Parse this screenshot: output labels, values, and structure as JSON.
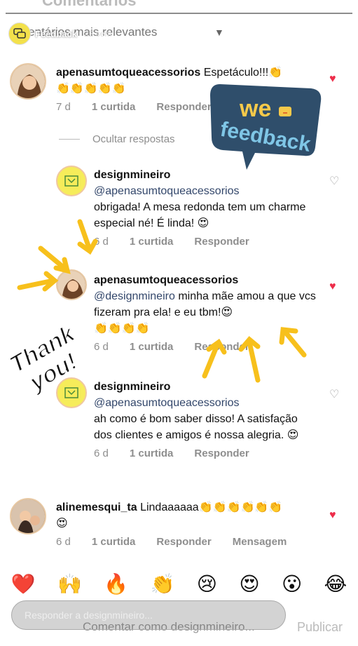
{
  "ghost_header": "Comentários",
  "story": {
    "name": "Feedback",
    "time": "22 sem",
    "ghost_subtitle": "mentários mais relevantes"
  },
  "comments": [
    {
      "username": "apenasumtoqueacessorios",
      "text": "Espetáculo!!!👏",
      "text2": "👏👏👏👏👏",
      "time": "7 d",
      "likes": "1 curtida",
      "reply": "Responder",
      "liked": true
    },
    {
      "username": "designmineiro",
      "mention": "@apenasumtoqueacessorios",
      "text": "obrigada! A mesa redonda tem um charme especial né! É linda! 😍",
      "time": "6 d",
      "likes": "1 curtida",
      "reply": "Responder",
      "liked": false
    },
    {
      "username": "apenasumtoqueacessorios",
      "mention": "@designmineiro",
      "text": "minha mãe amou a que vcs fizeram pra ela! e eu tbm!😍",
      "text2": "👏👏👏👏",
      "time": "6 d",
      "likes": "1 curtida",
      "reply": "Responder",
      "liked": true
    },
    {
      "username": "designmineiro",
      "mention": "@apenasumtoqueacessorios",
      "text": "ah como é bom saber disso! A satisfação dos clientes e amigos é nossa alegria. 😍",
      "time": "6 d",
      "likes": "1 curtida",
      "reply": "Responder",
      "liked": false
    },
    {
      "username": "alinemesqui_ta",
      "text": "Lindaaaaaa👏👏👏👏👏👏",
      "text2": "😍",
      "time": "6 d",
      "likes": "1 curtida",
      "reply": "Responder",
      "message": "Mensagem",
      "liked": true
    }
  ],
  "hide_replies": "Ocultar respostas",
  "emoji_bar": [
    "❤️",
    "🙌",
    "🔥",
    "👏",
    "😢",
    "😍",
    "😮",
    "😂"
  ],
  "compose": {
    "placeholder": "Responder a designmineiro...",
    "ghost_text": "Comentar como designmineiro...",
    "ghost_publish": "Publicar"
  },
  "stickers": {
    "we_top": "we",
    "we_bottom": "feedback",
    "thanks_line1": "Thank",
    "thanks_line2": "you!"
  },
  "colors": {
    "heart_red": "#ed2d4a",
    "arrow_yellow": "#f7c01c",
    "sticker_bg": "#2f4e6b",
    "sticker_yellow": "#f6c94a"
  }
}
